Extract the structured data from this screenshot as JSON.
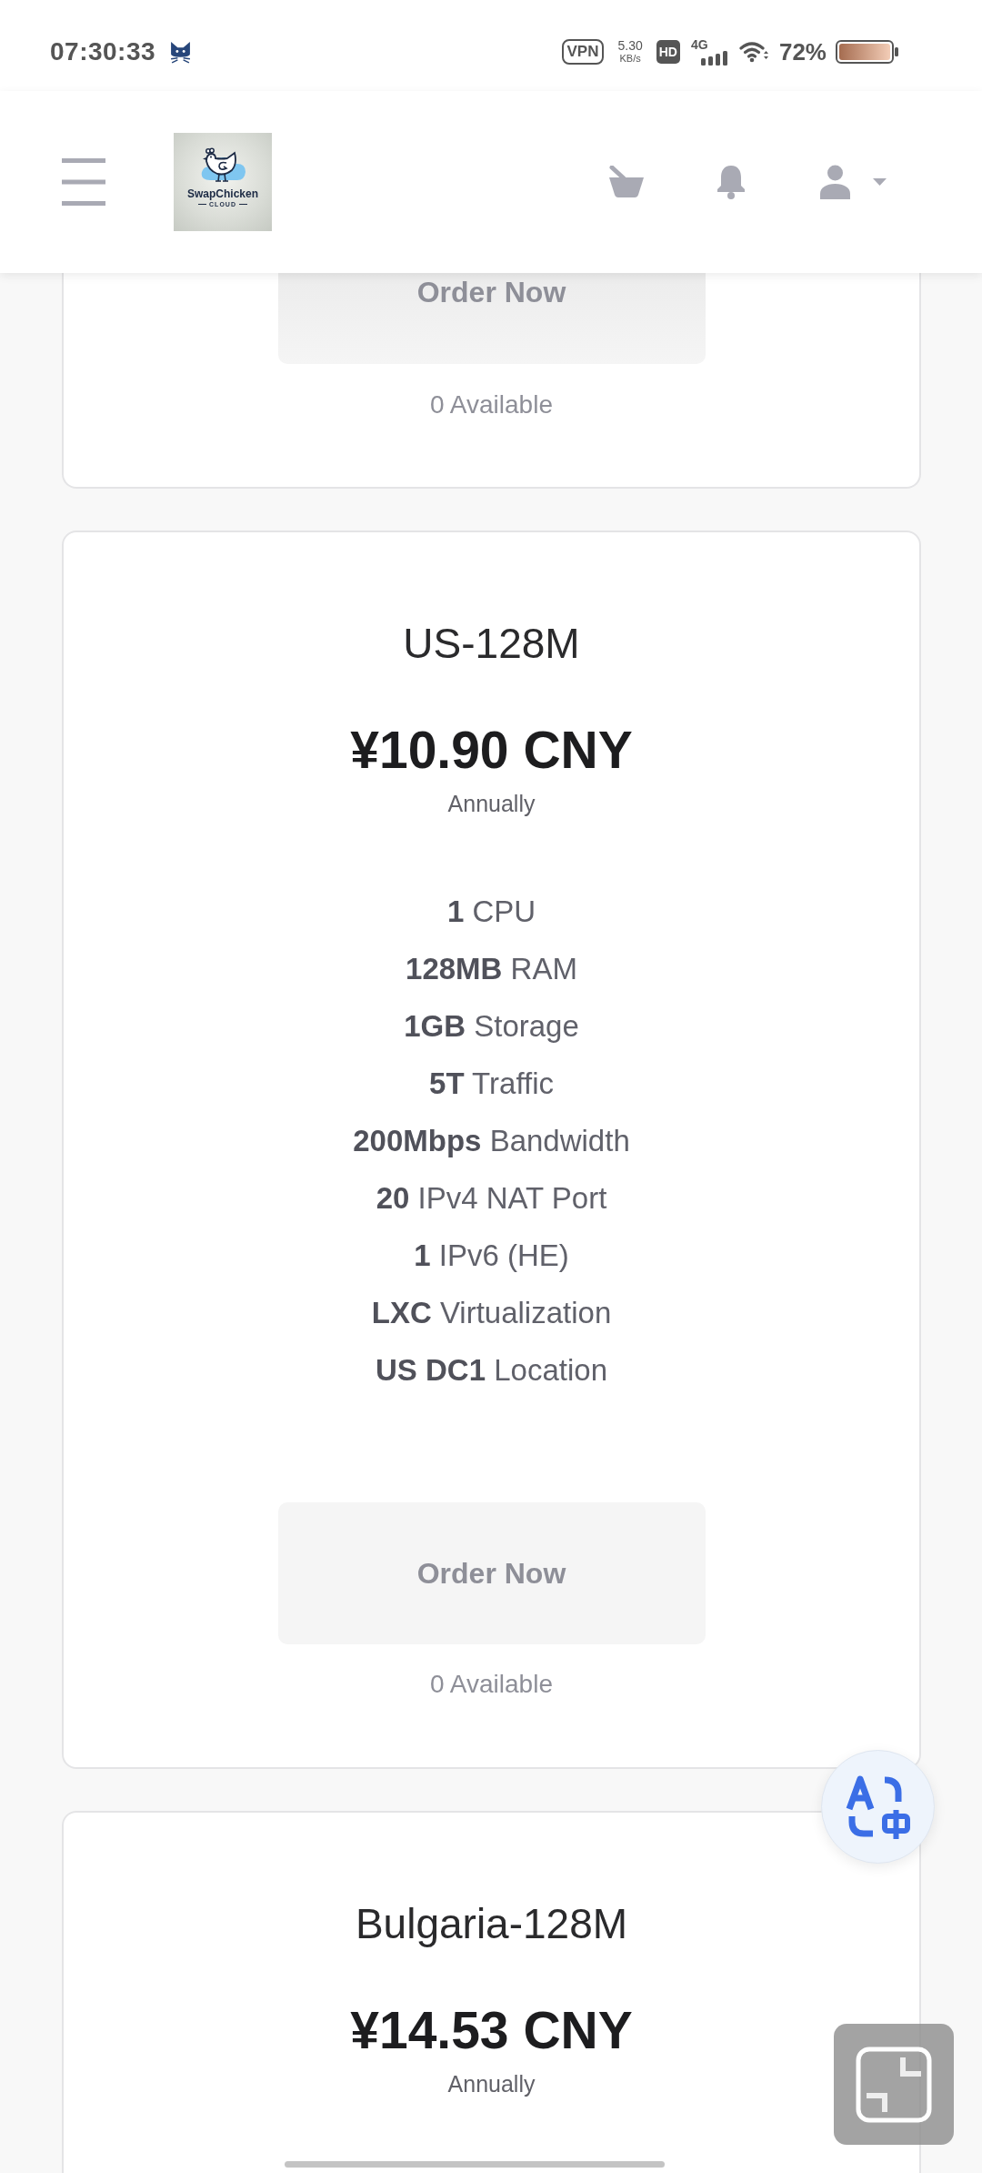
{
  "status_bar": {
    "time": "07:30:33",
    "vpn": "VPN",
    "speed_value": "5.30",
    "speed_unit": "KB/s",
    "hd": "HD",
    "network": "4G",
    "battery": "72%"
  },
  "header": {
    "logo": {
      "name": "SwapChicken",
      "tagline": "CLOUD"
    }
  },
  "plans": [
    {
      "order_button": {
        "label": "Order Now",
        "disabled": true
      },
      "availability": "0 Available"
    },
    {
      "title": "US-128M",
      "price": "¥10.90 CNY",
      "period": "Annually",
      "features": [
        "**1** CPU",
        "**128MB** RAM",
        "**1GB** Storage",
        "**5T** Traffic",
        "**200Mbps** Bandwidth",
        "**20** IPv4 NAT Port",
        "**1** IPv6 (HE)",
        "**LXC** Virtualization",
        "**US DC1** Location"
      ],
      "order_button": {
        "label": "Order Now",
        "disabled": true
      },
      "availability": "0 Available"
    },
    {
      "title": "Bulgaria-128M",
      "price": "¥14.53 CNY",
      "period": "Annually"
    }
  ]
}
